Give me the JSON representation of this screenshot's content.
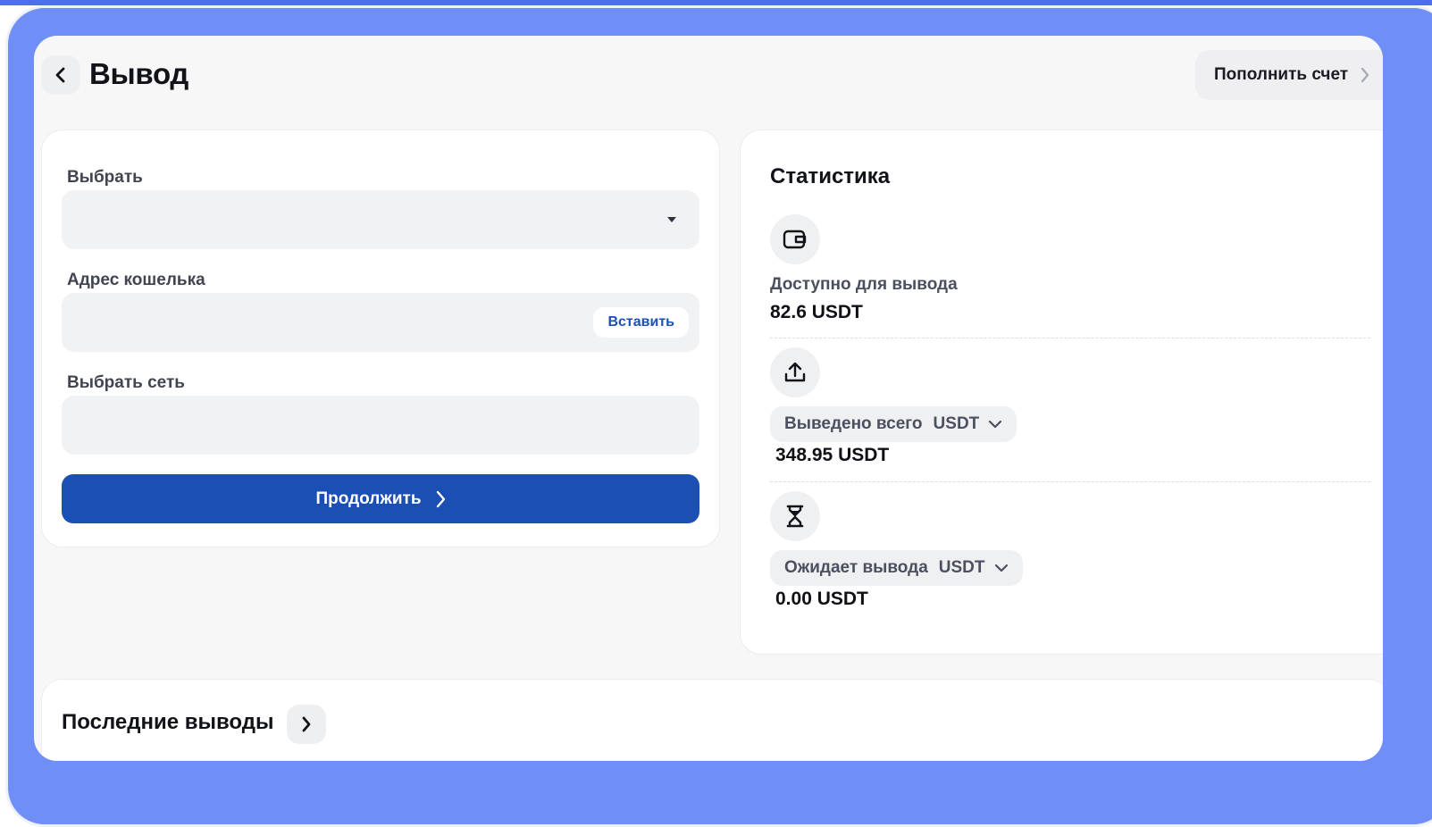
{
  "header": {
    "title": "Вывод",
    "back_icon": "chevron-left-icon",
    "topup_label": "Пополнить счет",
    "topup_icon": "chevron-right-icon"
  },
  "form": {
    "select_label": "Выбрать",
    "select_value": "",
    "select_icon": "caret-down-icon",
    "wallet_label": "Адрес кошелька",
    "wallet_value": "",
    "paste_label": "Вставить",
    "network_label": "Выбрать сеть",
    "network_value": "",
    "continue_label": "Продолжить",
    "continue_icon": "chevron-right-icon"
  },
  "stats": {
    "title": "Статистика",
    "items": [
      {
        "icon": "wallet-icon",
        "label": "Доступно для вывода",
        "value": "82.6 USDT"
      },
      {
        "icon": "upload-icon",
        "label": "Выведено всего",
        "currency": "USDT",
        "value": "348.95 USDT"
      },
      {
        "icon": "hourglass-icon",
        "label": "Ожидает вывода",
        "currency": "USDT",
        "value": "0.00 USDT"
      }
    ]
  },
  "recent": {
    "title": "Последние выводы",
    "icon": "chevron-right-icon"
  },
  "colors": {
    "frame": "#6f8ff7",
    "primary_button": "#1c4fb4",
    "link": "#1e4fb7",
    "page_background": "#f7f7f8"
  }
}
